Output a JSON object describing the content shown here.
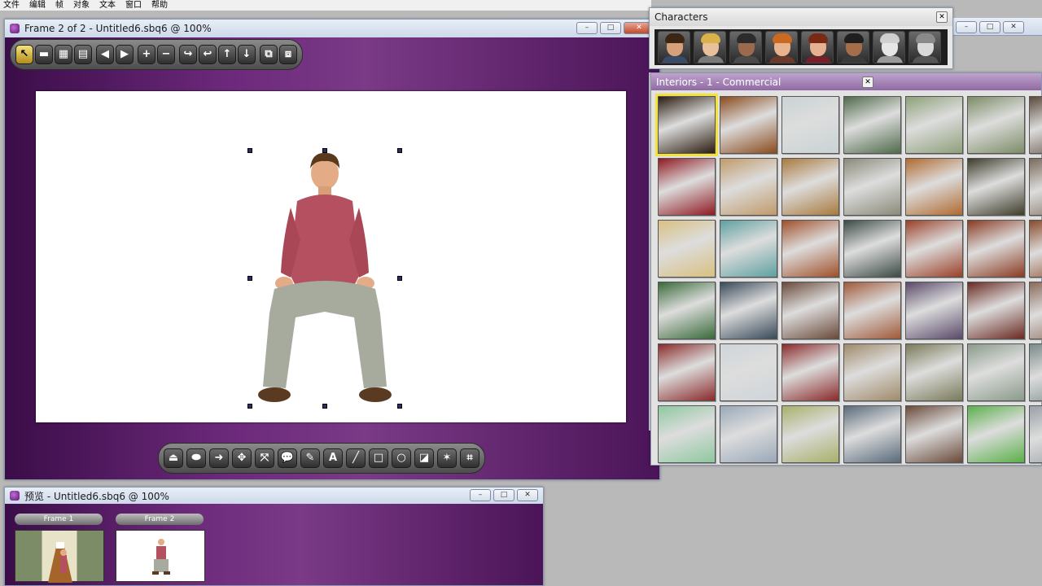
{
  "menu": [
    "文件",
    "编辑",
    "帧",
    "对象",
    "文本",
    "窗口",
    "帮助"
  ],
  "main_window": {
    "title": "Frame 2 of 2 - Untitled6.sbq6 @ 100%",
    "controls": {
      "minimize": "–",
      "maximize": "□",
      "close": "✕"
    }
  },
  "toolbar": {
    "groups": [
      [
        {
          "name": "select-arrow-icon",
          "glyph": "↖",
          "active": true
        },
        {
          "name": "frame-rect-icon",
          "glyph": "▬"
        },
        {
          "name": "grid-icon",
          "glyph": "▦"
        },
        {
          "name": "page-icon",
          "glyph": "▤"
        }
      ],
      [
        {
          "name": "prev-icon",
          "glyph": "◀"
        },
        {
          "name": "next-icon",
          "glyph": "▶"
        }
      ],
      [
        {
          "name": "add-icon",
          "glyph": "+"
        },
        {
          "name": "remove-icon",
          "glyph": "−"
        }
      ],
      [
        {
          "name": "move-right-icon",
          "glyph": "↪"
        },
        {
          "name": "move-left-icon",
          "glyph": "↩"
        },
        {
          "name": "move-up-icon",
          "glyph": "↑"
        },
        {
          "name": "move-down-icon",
          "glyph": "↓"
        }
      ],
      [
        {
          "name": "bring-forward-icon",
          "glyph": "⧉"
        },
        {
          "name": "send-back-icon",
          "glyph": "⧈"
        }
      ]
    ]
  },
  "bottom_toolbar": [
    {
      "name": "flip-down-icon",
      "glyph": "⏏"
    },
    {
      "name": "flip-up-icon",
      "glyph": "⬬"
    },
    {
      "name": "arrow-right-icon",
      "glyph": "➜"
    },
    {
      "name": "expand-icon",
      "glyph": "✥"
    },
    {
      "name": "shrink-icon",
      "glyph": "⤧"
    },
    {
      "name": "speech-bubble-icon",
      "glyph": "💬"
    },
    {
      "name": "pencil-icon",
      "glyph": "✎"
    },
    {
      "name": "text-icon",
      "glyph": "A"
    },
    {
      "name": "line-icon",
      "glyph": "╱"
    },
    {
      "name": "rectangle-icon",
      "glyph": "□"
    },
    {
      "name": "ellipse-icon",
      "glyph": "○"
    },
    {
      "name": "fill-icon",
      "glyph": "◪"
    },
    {
      "name": "magic-icon",
      "glyph": "✶"
    },
    {
      "name": "crop-icon",
      "glyph": "⌗"
    }
  ],
  "characters_panel": {
    "title": "Characters",
    "close": "✕",
    "characters": [
      {
        "skin": "#d8a07a",
        "hair": "#3b2614",
        "shirt": "#3a4a6a"
      },
      {
        "skin": "#e8c09a",
        "hair": "#d9b24a",
        "shirt": "#7a7a7a"
      },
      {
        "skin": "#9b6a4e",
        "hair": "#2b2b2b",
        "shirt": "#4a4a4a"
      },
      {
        "skin": "#e7b48e",
        "hair": "#c96a20",
        "shirt": "#6b3a2a"
      },
      {
        "skin": "#e7b090",
        "hair": "#7a2a14",
        "shirt": "#7a1e2a"
      },
      {
        "skin": "#a56e4a",
        "hair": "#1f1f1f",
        "shirt": "#3a3a3a"
      },
      {
        "skin": "#e6e6e6",
        "hair": "#cfcfcf",
        "shirt": "#9a9a9a"
      },
      {
        "skin": "#d9d9d9",
        "hair": "#8a8a8a",
        "shirt": "#555555"
      }
    ]
  },
  "interiors_panel": {
    "title": "Interiors - 1 - Commercial",
    "close": "✕",
    "thumbnails": [
      [
        "#2b1c10",
        "#8a4b1e",
        "#c9d3d5",
        "#4f6b4a",
        "#8ea07a",
        "#7c8c66",
        "#5a4a3a"
      ],
      [
        "#8e1a22",
        "#c09a6a",
        "#a87a3e",
        "#8a8a7a",
        "#b06a30",
        "#3e3c2a",
        "#7a6a5a"
      ],
      [
        "#d8c080",
        "#5fa0a0",
        "#a0502a",
        "#3c4a44",
        "#9a4028",
        "#8a3a22",
        "#8a4a2a"
      ],
      [
        "#3a6a3a",
        "#3a4a5a",
        "#6a4a3a",
        "#a05a3a",
        "#5a4a6a",
        "#6a2a22",
        "#8a6a5a"
      ],
      [
        "#8a2a2a",
        "#cfd5da",
        "#8a2a2a",
        "#a08a6a",
        "#7a7a5a",
        "#8a9a8a",
        "#7a8a8a"
      ],
      [
        "#8ec8a0",
        "#9aa8b8",
        "#a8b06a",
        "#5a6a7a",
        "#6a4a3a",
        "#5ab04a",
        "#9aa0a8"
      ]
    ]
  },
  "preview_window": {
    "title": "预览 - Untitled6.sbq6 @ 100%",
    "frames": [
      {
        "label": "Frame 1",
        "scene": "hallway"
      },
      {
        "label": "Frame 2",
        "scene": "blank"
      }
    ]
  },
  "colors": {
    "accent": "#6d2a7c",
    "selection": "#f3e23a",
    "handle": "#2d2d6a"
  }
}
